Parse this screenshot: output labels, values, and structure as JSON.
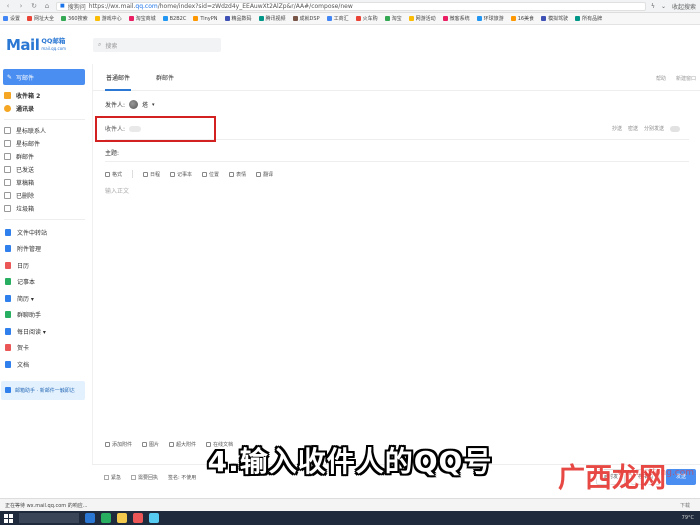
{
  "browser": {
    "tab_label": "搜狗问",
    "url_prefix": "https://wx.mail.",
    "url_domain": "qq.com",
    "url_path": "/home/index?sid=zWdzd4y_EEAuwXt2AlZp&r/AA#/compose/new",
    "right_label": "收起搜索"
  },
  "bookmarks": [
    "设置",
    "网址大全",
    "360搜索",
    "游戏中心",
    "淘宝商城",
    "B2B2C",
    "TinyPN",
    "精品数码",
    "腾讯视频",
    "成就DSP",
    "工商汇",
    "火车购",
    "淘宝",
    "网游活动",
    "微客系统",
    "环球旅游",
    "16美食",
    "模拟驾驶",
    "所有品牌"
  ],
  "app": {
    "logo_text": "Mail",
    "logo_cn": "QQ邮箱",
    "logo_domain": "mail.qq.com",
    "search_placeholder": "搜索"
  },
  "sidebar": {
    "compose": "写邮件",
    "items": [
      {
        "label": "收件箱 2",
        "icon": "inbox-icon",
        "color": "#f5a623",
        "strong": true
      },
      {
        "label": "通讯录",
        "icon": "contacts-icon",
        "color": "#f5a623",
        "strong": true
      }
    ],
    "folders": [
      {
        "label": "星标联系人",
        "icon": "star-icon"
      },
      {
        "label": "星标邮件",
        "icon": "star-mail-icon"
      },
      {
        "label": "群邮件",
        "icon": "group-icon"
      },
      {
        "label": "已发送",
        "icon": "sent-icon"
      },
      {
        "label": "草稿箱",
        "icon": "draft-icon"
      },
      {
        "label": "已删除",
        "icon": "trash-icon"
      },
      {
        "label": "垃圾箱",
        "icon": "spam-icon"
      }
    ],
    "apps": [
      {
        "label": "文件中转站",
        "color": "#2f80ed"
      },
      {
        "label": "附件管理",
        "color": "#2f80ed"
      },
      {
        "label": "日历",
        "color": "#eb5757"
      },
      {
        "label": "记事本",
        "color": "#27ae60"
      },
      {
        "label": "简历 ▾",
        "color": "#2f80ed"
      },
      {
        "label": "群聊助手",
        "color": "#27ae60"
      },
      {
        "label": "每日阅读 ▾",
        "color": "#2f80ed"
      },
      {
        "label": "贺卡",
        "color": "#eb5757"
      },
      {
        "label": "文档",
        "color": "#2f80ed"
      }
    ],
    "assistant": "邮箱助手 · 新邮件一触即达"
  },
  "compose": {
    "tabs": [
      "普通邮件",
      "群邮件"
    ],
    "tab_right": [
      "帮助",
      "新建窗口"
    ],
    "sender_label": "发件人:",
    "sender_name": "塔",
    "recipient_label": "收件人:",
    "recipient_chip": "",
    "recipient_right": [
      "抄送",
      "密送",
      "分别发送"
    ],
    "subject_label": "主题:",
    "toolbar": [
      "格式",
      "日程",
      "记事本",
      "位置",
      "表情",
      "翻译"
    ],
    "body_placeholder": "输入正文",
    "attach": [
      "添加附件",
      "图片",
      "超大附件",
      "在线文档"
    ],
    "footer_left": [
      "紧急",
      "需要回执",
      "签名: 不使用"
    ],
    "footer_right": [
      "定时发",
      "存草稿",
      "发送"
    ]
  },
  "caption": "4.输入收件人的QQ号",
  "watermark": "广西龙网",
  "watermark_sub": "www.gxlong.com",
  "statusbar": {
    "left": "正在等待 wx.mail.qq.com 的响应...",
    "right": "下载"
  },
  "taskbar": {
    "tray": "79°C"
  }
}
